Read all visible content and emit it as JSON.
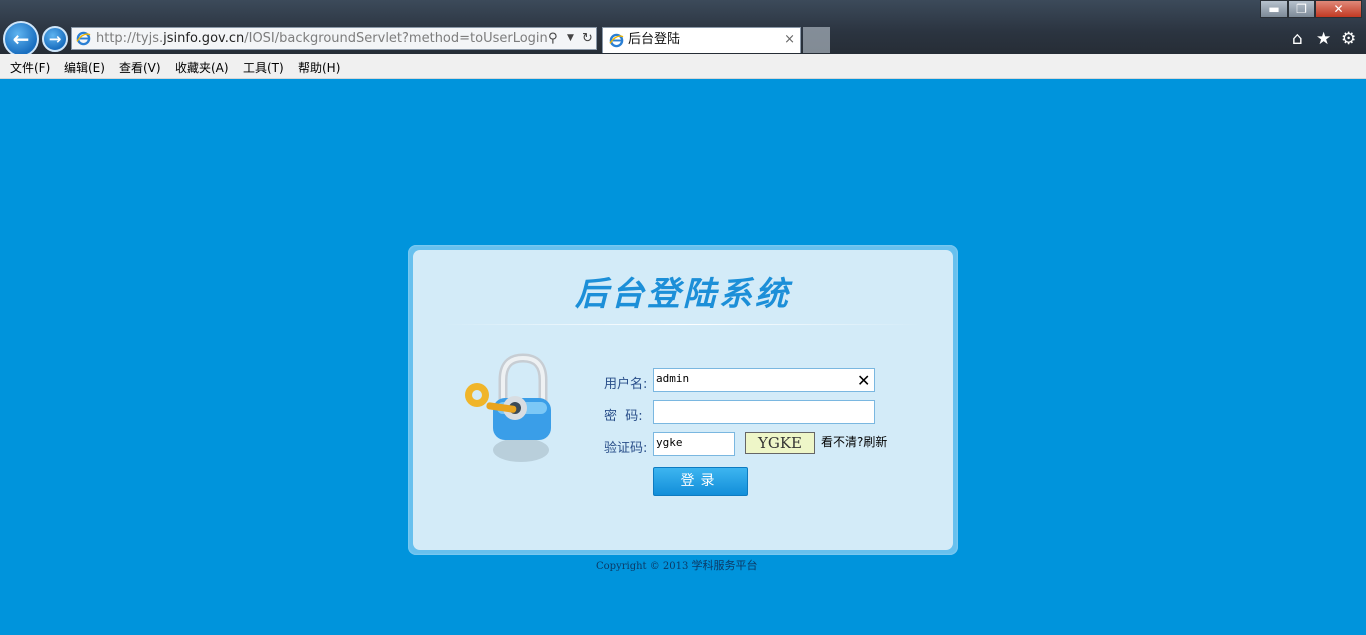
{
  "browser": {
    "url_prefix": "http://tyjs.",
    "url_domain": "jsinfo.gov.cn",
    "url_path": "/IOSI/backgroundServlet?method=toUserLogin",
    "tab_title": "后台登陆",
    "tab_close": "×",
    "window_buttons": {
      "minimize": "▬",
      "maximize": "❐",
      "close": "✕"
    }
  },
  "menu": [
    "文件(F)",
    "编辑(E)",
    "查看(V)",
    "收藏夹(A)",
    "工具(T)",
    "帮助(H)"
  ],
  "login": {
    "title": "后台登陆系统",
    "username_label": "用户名:",
    "username_value": "admin",
    "password_label": "密  码:",
    "password_value": "",
    "captcha_label": "验证码:",
    "captcha_value": "ygke",
    "captcha_image_text": "YGKE",
    "refresh_text": "看不清?刷新",
    "submit_label": "登录"
  },
  "footer": {
    "copyright": "Copyright © 2013 ",
    "platform": "学科服务平台"
  },
  "colors": {
    "background": "#0094dc",
    "panel": "#d3ebf8",
    "accent": "#1c8fd8"
  }
}
